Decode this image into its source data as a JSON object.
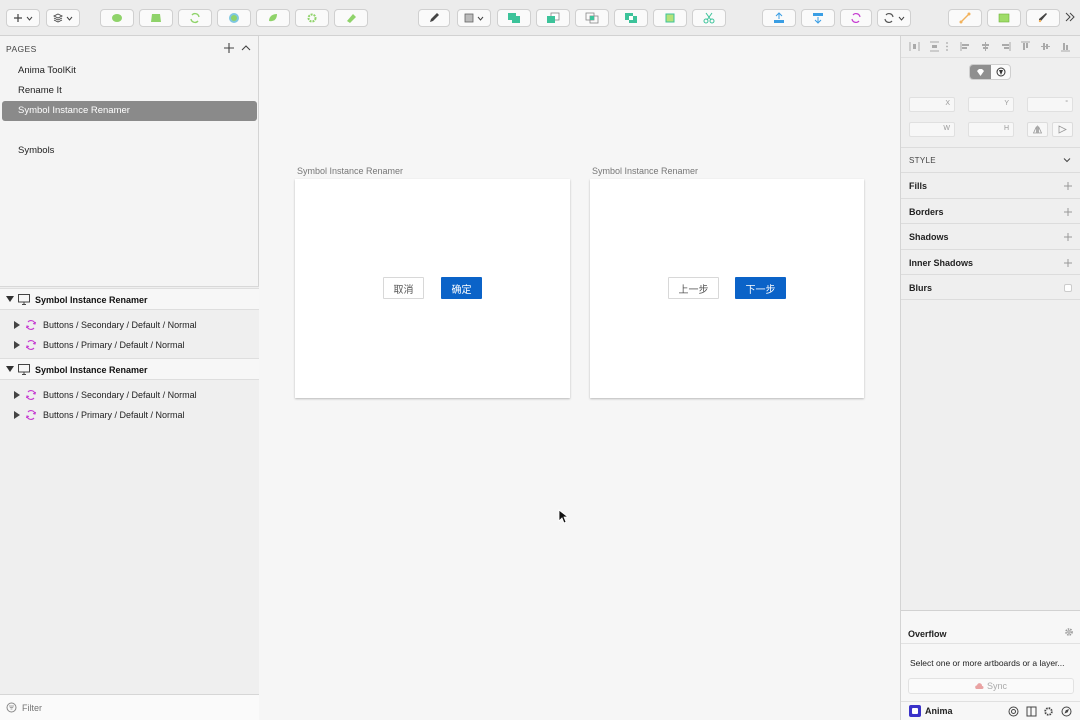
{
  "left_panel": {
    "pages_title": "PAGES",
    "pages": [
      {
        "label": "Anima ToolKit",
        "selected": false
      },
      {
        "label": "Rename It",
        "selected": false
      },
      {
        "label": "Symbol Instance Renamer",
        "selected": true
      },
      {
        "label": "Symbols",
        "selected": false
      }
    ],
    "layer_groups": [
      {
        "label": "Symbol Instance Renamer",
        "children": [
          "Buttons / Secondary / Default / Normal",
          "Buttons / Primary / Default / Normal"
        ]
      },
      {
        "label": "Symbol Instance Renamer",
        "children": [
          "Buttons / Secondary / Default / Normal",
          "Buttons / Primary / Default / Normal"
        ]
      }
    ],
    "filter_placeholder": "Filter"
  },
  "canvas": {
    "artboards": [
      {
        "title": "Symbol Instance Renamer",
        "secondary_label": "取消",
        "primary_label": "确定"
      },
      {
        "title": "Symbol Instance Renamer",
        "secondary_label": "上一步",
        "primary_label": "下一步"
      }
    ]
  },
  "inspector": {
    "fields": {
      "x": "X",
      "y": "Y",
      "rotation": "°",
      "w": "W",
      "h": "H"
    },
    "style_title": "STYLE",
    "sections": [
      "Fills",
      "Borders",
      "Shadows",
      "Inner Shadows",
      "Blurs"
    ],
    "overflow": {
      "title": "Overflow",
      "message": "Select one or more artboards or a layer...",
      "sync_label": "Sync"
    },
    "anima_label": "Anima"
  },
  "colors": {
    "primary_button": "#0b63c8",
    "selected_page": "#8a8a8a",
    "toolbar_green": "#3cc39a",
    "toolbar_orange": "#f2b25c",
    "symbol_icon": "#c63bd1"
  }
}
